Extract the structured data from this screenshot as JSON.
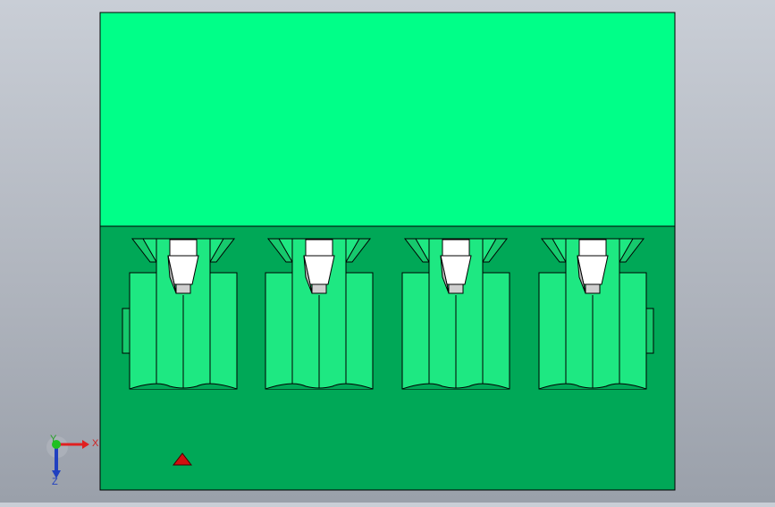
{
  "viewport": {
    "background_top": "#c9ced6",
    "background_bottom": "#9aa0aa"
  },
  "model": {
    "name": "connector-block-front-view",
    "colors": {
      "top_face": "#00ff88",
      "lower_body": "#00a857",
      "pin_block": "#1ee882",
      "pin_block_dark": "#16c96d",
      "contact": "#ffffff",
      "contact_tip": "#cfcfcf",
      "edge": "#000000"
    },
    "pin_count": 4
  },
  "triad": {
    "x_label": "X",
    "y_label": "Y",
    "z_label": "Z",
    "x_color": "#e02020",
    "y_color": "#20c020",
    "z_color": "#2040c0"
  },
  "origin_marker": {
    "color": "#d01010",
    "icon": "triangle-marker-icon"
  }
}
